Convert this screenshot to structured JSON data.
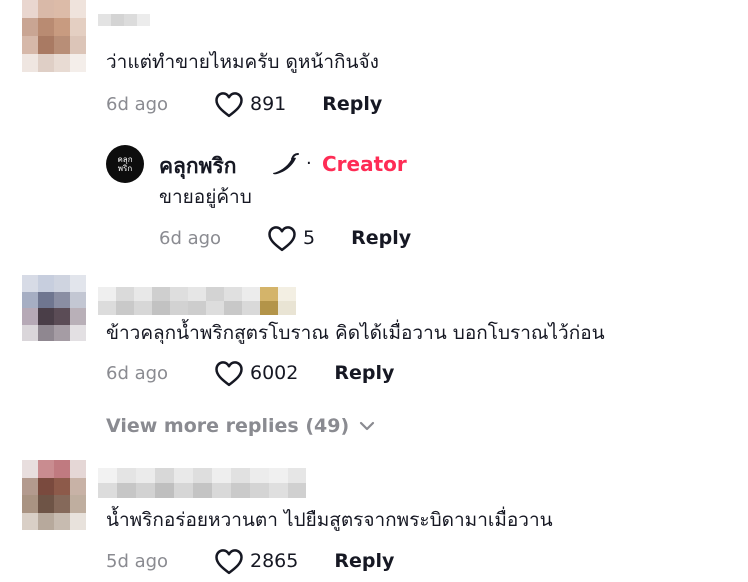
{
  "comments": [
    {
      "text": "ว่าแต่ทำขายไหมครับ ดูหน้ากินจัง",
      "time": "6d ago",
      "likes": "891",
      "reply_label": "Reply"
    },
    {
      "text": "ข้าวคลุกน้ำพริกสูตรโบราณ คิดได้เมื่อวาน บอกโบราณไว้ก่อน",
      "time": "6d ago",
      "likes": "6002",
      "reply_label": "Reply"
    },
    {
      "text": "น้ำพริกอร่อยหวานตา ไปยืมสูตรจากพระบิดามาเมื่อวาน",
      "time": "5d ago",
      "likes": "2865",
      "reply_label": "Reply"
    }
  ],
  "creator_reply": {
    "name": "คลุกพริก",
    "badge": "Creator",
    "separator": "·",
    "avatar_line1": "คลุก",
    "avatar_line2": "พริก",
    "text": "ขายอยู่ค้าบ",
    "time": "6d ago",
    "likes": "5",
    "reply_label": "Reply"
  },
  "view_more_label": "View more replies (49)",
  "colors": {
    "creator_badge": "#fe2c55",
    "secondary_text": "#8a8b91",
    "primary_text": "#161823"
  }
}
